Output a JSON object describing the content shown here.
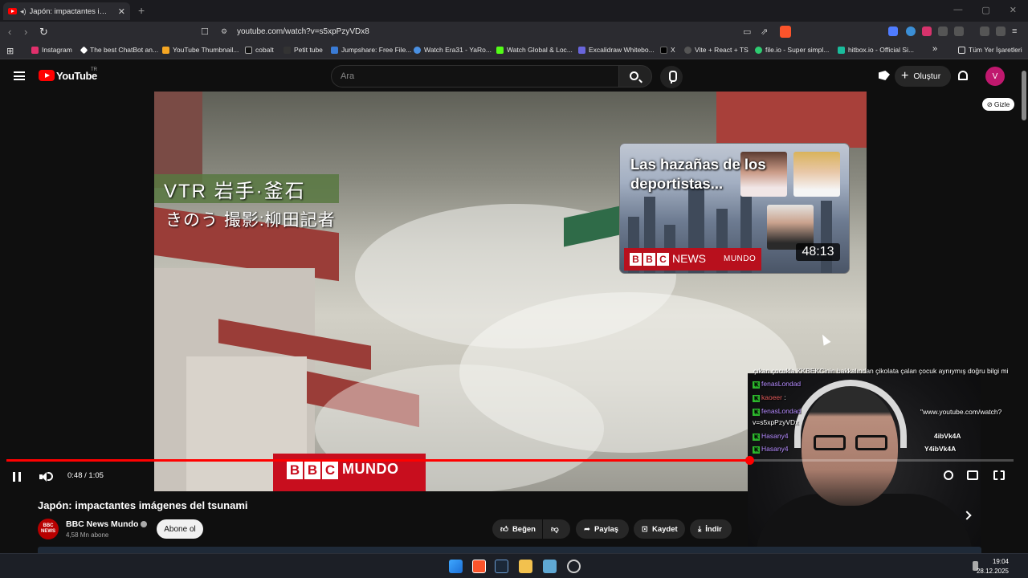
{
  "browser": {
    "tab_title": "Japón: impactantes imágenes",
    "new_tab_symbol": "+",
    "url": "youtube.com/watch?v=s5xpPzyVDx8",
    "bookmarks": [
      {
        "label": "Instagram",
        "color": "#e1306c"
      },
      {
        "label": "The best ChatBot an...",
        "color": "#ffffff"
      },
      {
        "label": "YouTube Thumbnail...",
        "color": "#f5a623"
      },
      {
        "label": "cobalt",
        "color": "#ffffff"
      },
      {
        "label": "Petit tube",
        "color": "#333333"
      },
      {
        "label": "Jumpshare: Free File...",
        "color": "#3a7bd5"
      },
      {
        "label": "Watch Era31 - YaRo...",
        "color": "#4a90e2"
      },
      {
        "label": "Watch Global & Loc...",
        "color": "#53fc18"
      },
      {
        "label": "Excalidraw Whitebo...",
        "color": "#6965db"
      },
      {
        "label": "X",
        "color": "#000000"
      },
      {
        "label": "Vite + React + TS",
        "color": "#9b59b6"
      },
      {
        "label": "file.io - Super simpl...",
        "color": "#2ecc71"
      },
      {
        "label": "hitbox.io - Official Si...",
        "color": "#1abc9c"
      }
    ],
    "bookmarks_overflow": "»",
    "all_bookmarks": "Tüm Yer İşaretleri"
  },
  "youtube": {
    "logo_text": "YouTube",
    "country_code": "TR",
    "search_placeholder": "Ara",
    "create_label": "Oluştur",
    "avatar_letter": "V"
  },
  "video": {
    "overlay_vtr": "VTR 岩手·釜石",
    "overlay_sub": "きのう 撮影:柳田記者",
    "bbc_letters": [
      "B",
      "B",
      "C"
    ],
    "bbc_mundo": "MUNDO",
    "hide_label": "Gizle",
    "time": "0:48 / 1:05",
    "progress_fraction": 0.738
  },
  "endcard": {
    "title": "Las hazañas de los deportistas...",
    "bbc_letters": [
      "B",
      "B",
      "C"
    ],
    "news": "NEWS",
    "mundo": "MUNDO",
    "duration": "48:13"
  },
  "chat": {
    "top_line": "çıkan çocukla KKBEKCinin bakkalından çikolata çalan çocuk aynıymış doğru bilgi mi",
    "lines": [
      {
        "user": "fenasLondad",
        "text": ""
      },
      {
        "user": "kaoeer",
        "text": ":"
      },
      {
        "user": "fenasLondad",
        "text": "\"www.youtube.com/watch?"
      },
      {
        "user": "",
        "text": "v=s5xpPzyVDx"
      },
      {
        "user": "Hasany4",
        "text": "4ibVk4A"
      },
      {
        "user": "Hasany4",
        "text": "Y4ibVk4A"
      }
    ]
  },
  "meta": {
    "video_title": "Japón: impactantes imágenes del tsunami",
    "channel_name": "BBC News Mundo",
    "channel_avatar": "BBC NEWS",
    "subscribers": "4,58 Mn abone",
    "subscribe_label": "Abone ol",
    "like_label": "Beğen",
    "share_label": "Paylaş",
    "save_label": "Kaydet",
    "download_label": "İndir"
  },
  "taskbar": {
    "time": "19:04",
    "date": "28.12.2025"
  }
}
